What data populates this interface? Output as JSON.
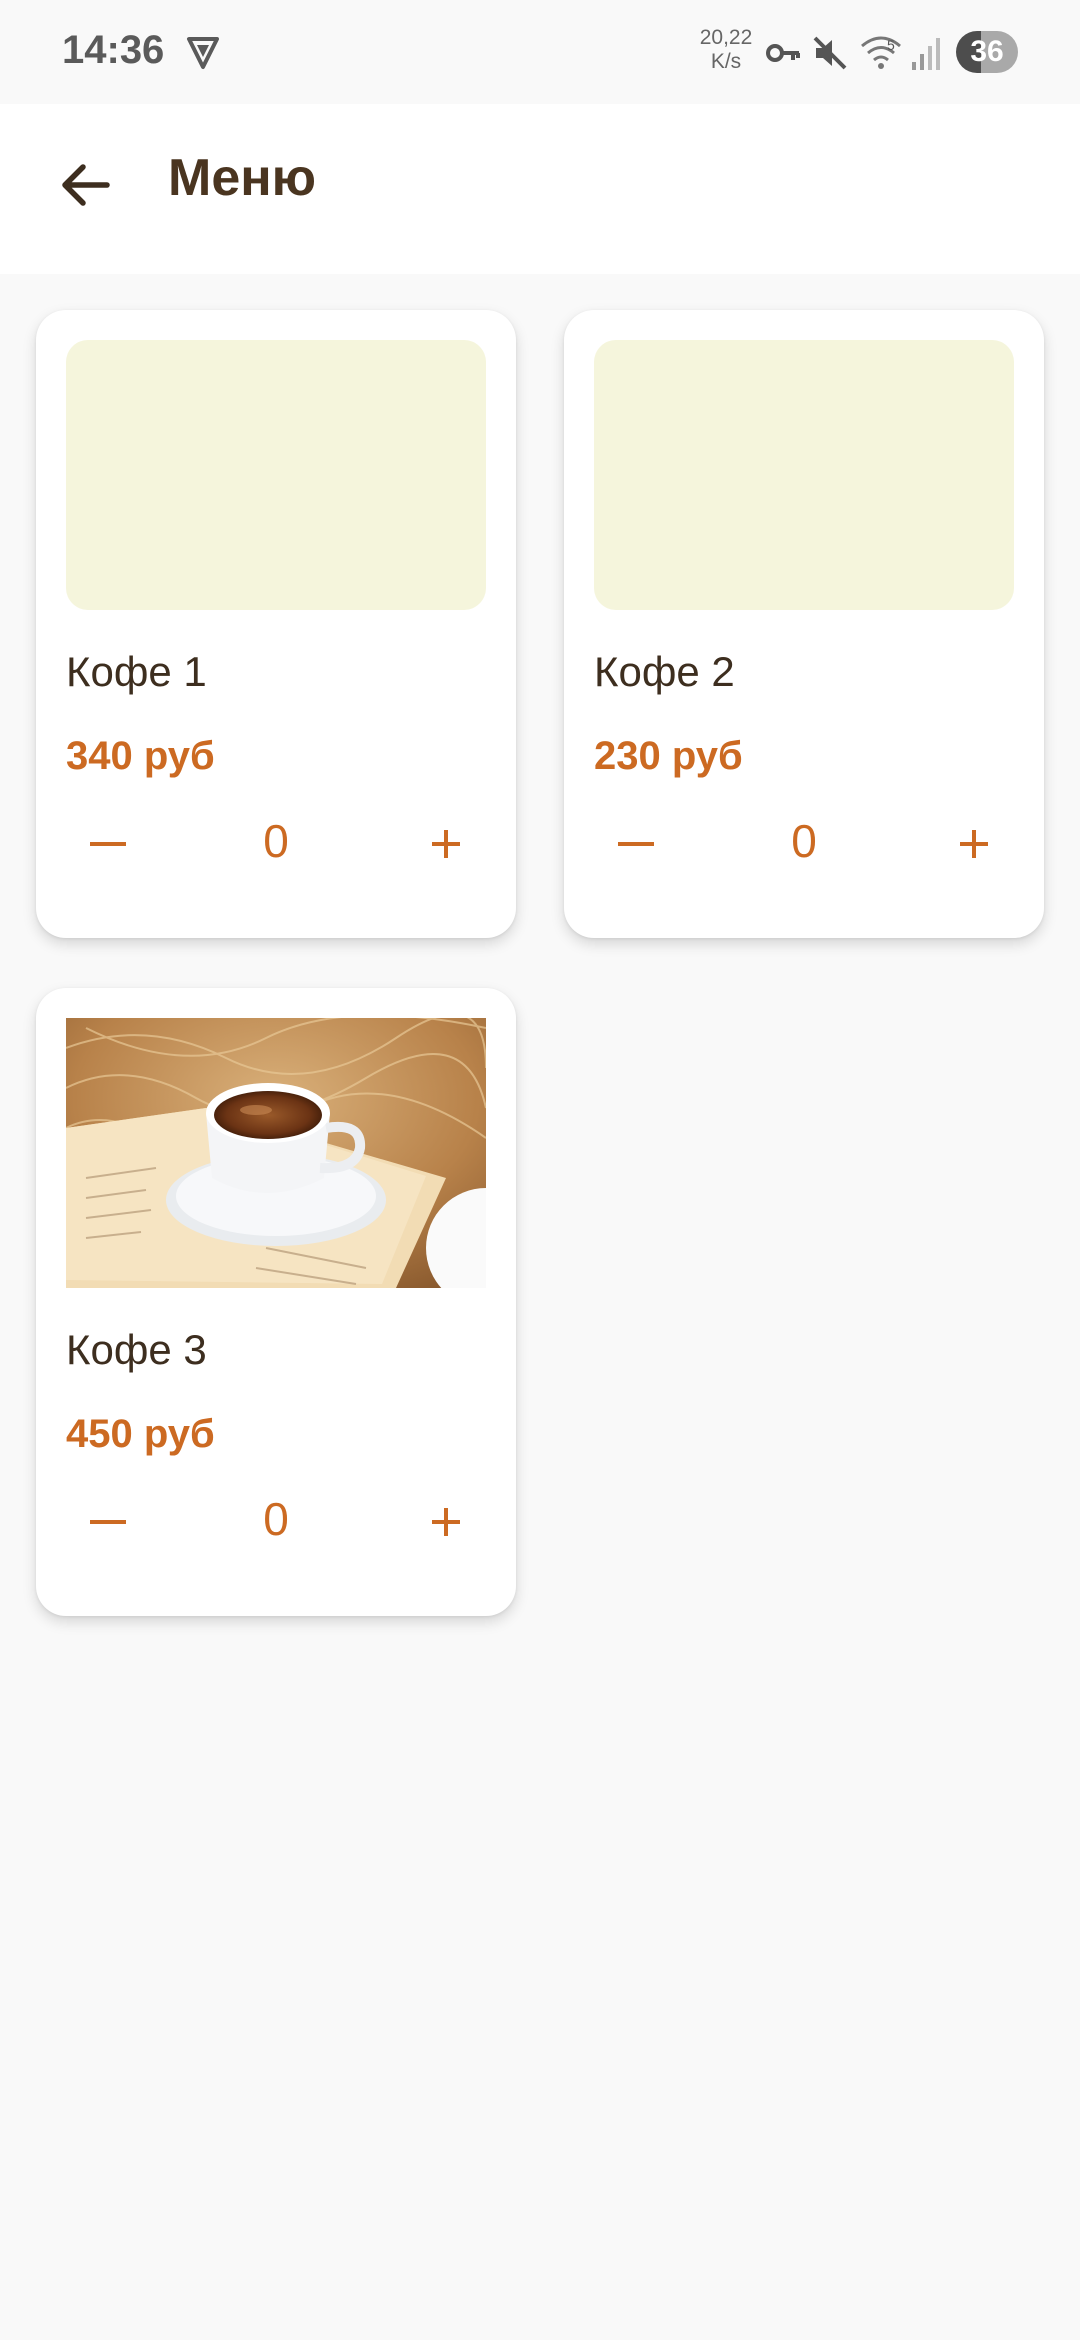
{
  "status_bar": {
    "time": "14:36",
    "net_speed_value": "20,22",
    "net_speed_unit": "K/s",
    "wifi_badge": "5",
    "battery": "36",
    "icons": [
      "vpn-shield-icon",
      "key-icon",
      "mute-icon",
      "wifi-icon",
      "signal-icon",
      "battery-icon"
    ]
  },
  "app_bar": {
    "title": "Меню",
    "back_icon": "arrow-left-icon"
  },
  "colors": {
    "accent": "#cc6a22",
    "title": "#4a3520",
    "placeholder": "#f5f5dc",
    "background": "#f9f9f9"
  },
  "products": [
    {
      "name": "Кофе 1",
      "price": "340 руб",
      "quantity": "0",
      "image": "placeholder"
    },
    {
      "name": "Кофе 2",
      "price": "230 руб",
      "quantity": "0",
      "image": "placeholder"
    },
    {
      "name": "Кофе 3",
      "price": "450 руб",
      "quantity": "0",
      "image": "coffee-cup-photo"
    }
  ]
}
